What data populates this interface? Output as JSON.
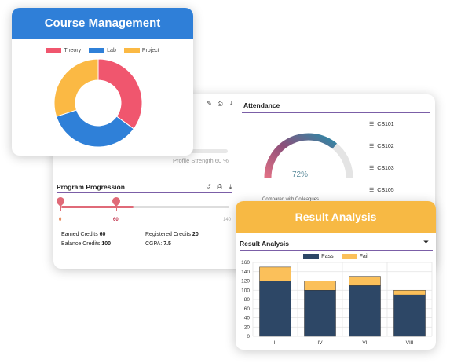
{
  "dashboard": {
    "profile": {
      "strength_text": "Profile Strength 60 %",
      "strength": 0.6
    },
    "progression": {
      "title": "Program Progression",
      "start_tick": "0",
      "current_tick": "60",
      "end_tick": "140",
      "progress_fraction": 0.43,
      "earned_label": "Earned Credits",
      "earned_value": "60",
      "registered_label": "Registered Credits",
      "registered_value": "20",
      "balance_label": "Balance Credits",
      "balance_value": "100",
      "cgpa_label": "CGPA:",
      "cgpa_value": "7.5"
    },
    "attendance": {
      "title": "Attendance",
      "percent_text": "72%",
      "percent": 72,
      "compare_text": "Compared with Colleagues",
      "courses": [
        "CS101",
        "CS102",
        "CS103",
        "CS105"
      ]
    }
  },
  "course_management": {
    "title": "Course Management",
    "chart_data": {
      "type": "pie",
      "categories": [
        "Theory",
        "Lab",
        "Project"
      ],
      "values": [
        35,
        35,
        30
      ],
      "colors": [
        "#f0566e",
        "#2f80d8",
        "#fbb944"
      ]
    }
  },
  "result_analysis": {
    "header": "Result Analysis",
    "title": "Result Analysis",
    "chart_data": {
      "type": "bar",
      "stacked": true,
      "categories": [
        "II",
        "IV",
        "VI",
        "VIII"
      ],
      "series": [
        {
          "name": "Pass",
          "values": [
            120,
            100,
            110,
            90
          ],
          "color": "#2d4766"
        },
        {
          "name": "Fail",
          "values": [
            30,
            20,
            20,
            10
          ],
          "color": "#fbc05a"
        }
      ],
      "ylim": [
        0,
        160
      ],
      "yticks": [
        "0",
        "20",
        "40",
        "60",
        "80",
        "100",
        "120",
        "140",
        "160"
      ],
      "grid": true,
      "legend": "top"
    }
  }
}
